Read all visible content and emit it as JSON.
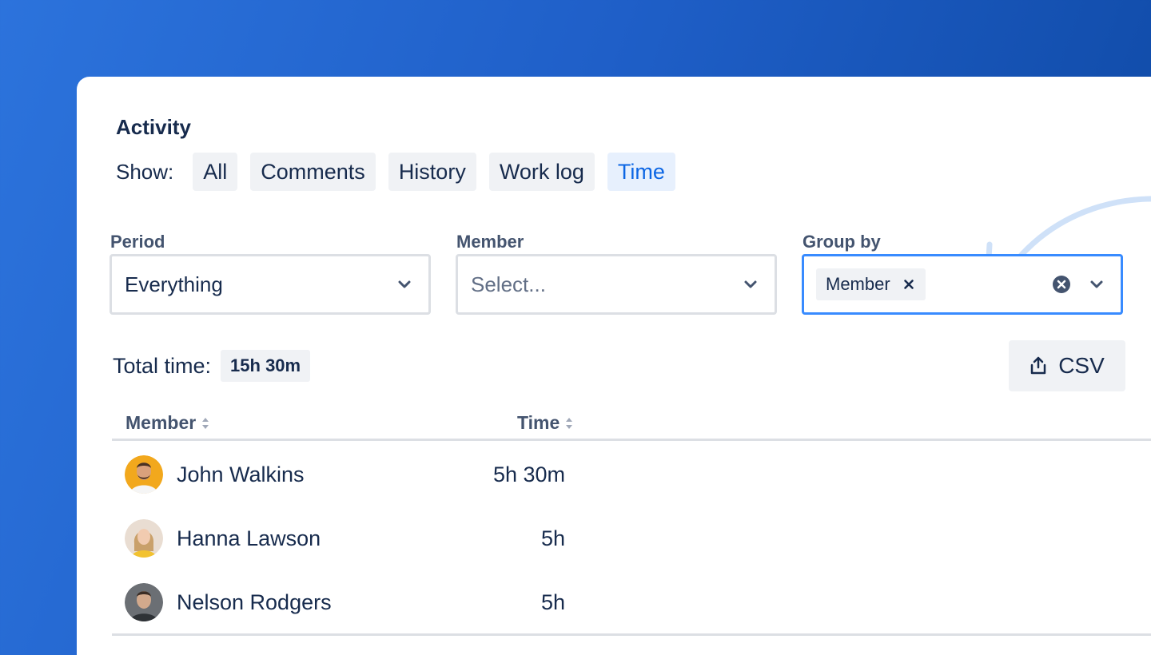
{
  "activity": {
    "title": "Activity",
    "show_label": "Show:",
    "tabs": [
      {
        "label": "All",
        "active": false
      },
      {
        "label": "Comments",
        "active": false
      },
      {
        "label": "History",
        "active": false
      },
      {
        "label": "Work log",
        "active": false
      },
      {
        "label": "Time",
        "active": true
      }
    ]
  },
  "filters": {
    "period": {
      "label": "Period",
      "value": "Everything"
    },
    "member": {
      "label": "Member",
      "placeholder": "Select..."
    },
    "group_by": {
      "label": "Group by",
      "tag": "Member"
    }
  },
  "summary": {
    "total_label": "Total time:",
    "total_value": "15h 30m",
    "export_label": "CSV"
  },
  "table": {
    "columns": [
      "Member",
      "Time"
    ],
    "rows": [
      {
        "name": "John Walkins",
        "time": "5h 30m"
      },
      {
        "name": "Hanna Lawson",
        "time": "5h"
      },
      {
        "name": "Nelson Rodgers",
        "time": "5h"
      }
    ]
  },
  "colors": {
    "accent": "#0c66e4",
    "focus_border": "#388bff",
    "background_start": "#2c73dc",
    "background_end": "#0d47a1"
  },
  "icons": [
    "chevron-down-icon",
    "close-icon",
    "clear-circle-icon",
    "upload-icon",
    "sort-icon",
    "curved-arrow-icon"
  ]
}
